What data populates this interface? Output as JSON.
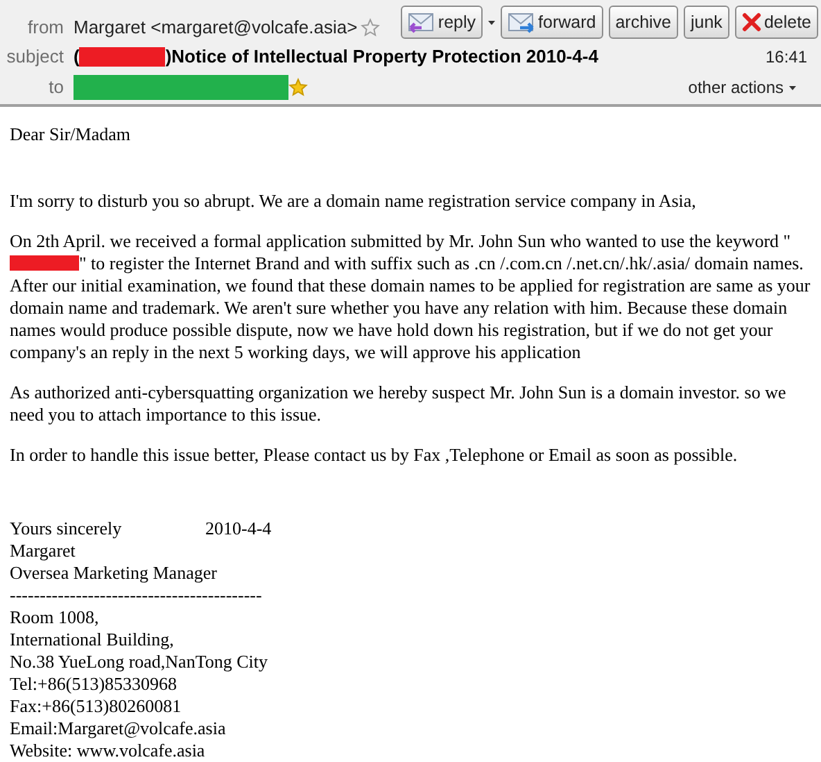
{
  "header": {
    "from_label": "from",
    "from": "Margaret <margaret@volcafe.asia>",
    "from_starred": false,
    "subject_label": "subject",
    "subject_before": "(",
    "subject_redacted": true,
    "subject_after": ")Notice of Intellectual Property Protection 2010-4-4",
    "to_label": "to",
    "to_redacted": true,
    "to_starred": true,
    "time": "16:41",
    "other_actions": "other actions"
  },
  "buttons": [
    {
      "kind": "reply",
      "label": "reply"
    },
    {
      "kind": "forward",
      "label": "forward"
    },
    {
      "kind": "plain",
      "label": "archive"
    },
    {
      "kind": "plain",
      "label": "junk"
    },
    {
      "kind": "delete",
      "label": "delete"
    }
  ],
  "body": {
    "greeting": "Dear Sir/Madam",
    "paragraphs": [
      {
        "lines": [
          {
            "text": "I'm sorry to disturb you so abrupt. We are a domain name registration service company in Asia,"
          }
        ]
      },
      {
        "lines": [
          {
            "text": "On 2th April. we received a formal application submitted by Mr. John Sun who wanted to use the keyword \"",
            "redacted": true,
            "after": "\" to register the Internet Brand and with suffix such as .cn /.com.cn /.net.cn/.hk/.asia/ domain names."
          },
          {
            "text": "After our initial examination, we found that these domain names to be applied for registration  are same as your  domain name and trademark. We aren't sure whether you have any relation with him. Because these domain names would produce possible dispute, now we have hold down his registration, but if we do not get your company's an reply in the next 5 working days, we will approve his application"
          }
        ]
      },
      {
        "lines": [
          {
            "text": "As authorized anti-cybersquatting organization we hereby suspect Mr. John Sun is a domain investor. so we need you to attach importance to this issue."
          }
        ]
      },
      {
        "lines": [
          {
            "text": "In order to handle this issue better, Please contact us by Fax ,Telephone or Email as soon as possible."
          }
        ]
      }
    ],
    "closing": "Yours sincerely",
    "closing_date": "2010-4-4",
    "signature": [
      "Margaret",
      "Oversea Marketing Manager",
      "------------------------------------------",
      "Room 1008,",
      "International Building,",
      "No.38 YueLong road,NanTong City",
      "Tel:+86(513)85330968",
      "Fax:+86(513)80260081",
      "Email:Margaret@volcafe.asia",
      "Website: www.volcafe.asia"
    ]
  }
}
